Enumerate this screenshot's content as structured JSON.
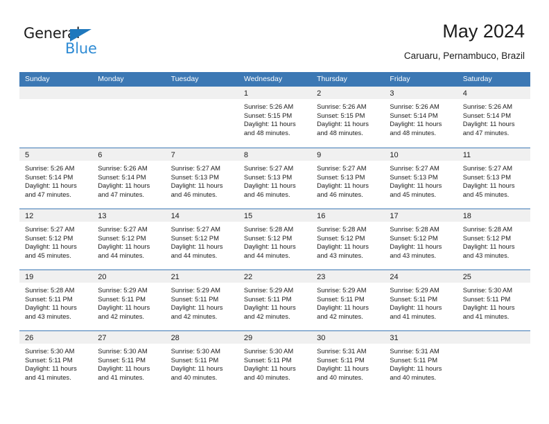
{
  "brand": {
    "name_top": "General",
    "name_bottom": "Blue",
    "triangle_icon": "triangle-icon",
    "color_dark": "#1b1b1b",
    "color_blue": "#2e8bd4",
    "triangle_color": "#1f78bd"
  },
  "header": {
    "title": "May 2024",
    "subtitle": "Caruaru, Pernambuco, Brazil"
  },
  "theme": {
    "header_bg": "#3c78b4",
    "header_text": "#ffffff",
    "day_band_bg": "#f0f0f0",
    "row_divider": "#3c78b4",
    "page_bg": "#ffffff",
    "text": "#1b1b1b"
  },
  "weekdays": [
    "Sunday",
    "Monday",
    "Tuesday",
    "Wednesday",
    "Thursday",
    "Friday",
    "Saturday"
  ],
  "weeks": [
    [
      {
        "day": "",
        "lines": []
      },
      {
        "day": "",
        "lines": []
      },
      {
        "day": "",
        "lines": []
      },
      {
        "day": "1",
        "lines": [
          "Sunrise: 5:26 AM",
          "Sunset: 5:15 PM",
          "Daylight: 11 hours",
          "and 48 minutes."
        ]
      },
      {
        "day": "2",
        "lines": [
          "Sunrise: 5:26 AM",
          "Sunset: 5:15 PM",
          "Daylight: 11 hours",
          "and 48 minutes."
        ]
      },
      {
        "day": "3",
        "lines": [
          "Sunrise: 5:26 AM",
          "Sunset: 5:14 PM",
          "Daylight: 11 hours",
          "and 48 minutes."
        ]
      },
      {
        "day": "4",
        "lines": [
          "Sunrise: 5:26 AM",
          "Sunset: 5:14 PM",
          "Daylight: 11 hours",
          "and 47 minutes."
        ]
      }
    ],
    [
      {
        "day": "5",
        "lines": [
          "Sunrise: 5:26 AM",
          "Sunset: 5:14 PM",
          "Daylight: 11 hours",
          "and 47 minutes."
        ]
      },
      {
        "day": "6",
        "lines": [
          "Sunrise: 5:26 AM",
          "Sunset: 5:14 PM",
          "Daylight: 11 hours",
          "and 47 minutes."
        ]
      },
      {
        "day": "7",
        "lines": [
          "Sunrise: 5:27 AM",
          "Sunset: 5:13 PM",
          "Daylight: 11 hours",
          "and 46 minutes."
        ]
      },
      {
        "day": "8",
        "lines": [
          "Sunrise: 5:27 AM",
          "Sunset: 5:13 PM",
          "Daylight: 11 hours",
          "and 46 minutes."
        ]
      },
      {
        "day": "9",
        "lines": [
          "Sunrise: 5:27 AM",
          "Sunset: 5:13 PM",
          "Daylight: 11 hours",
          "and 46 minutes."
        ]
      },
      {
        "day": "10",
        "lines": [
          "Sunrise: 5:27 AM",
          "Sunset: 5:13 PM",
          "Daylight: 11 hours",
          "and 45 minutes."
        ]
      },
      {
        "day": "11",
        "lines": [
          "Sunrise: 5:27 AM",
          "Sunset: 5:13 PM",
          "Daylight: 11 hours",
          "and 45 minutes."
        ]
      }
    ],
    [
      {
        "day": "12",
        "lines": [
          "Sunrise: 5:27 AM",
          "Sunset: 5:12 PM",
          "Daylight: 11 hours",
          "and 45 minutes."
        ]
      },
      {
        "day": "13",
        "lines": [
          "Sunrise: 5:27 AM",
          "Sunset: 5:12 PM",
          "Daylight: 11 hours",
          "and 44 minutes."
        ]
      },
      {
        "day": "14",
        "lines": [
          "Sunrise: 5:27 AM",
          "Sunset: 5:12 PM",
          "Daylight: 11 hours",
          "and 44 minutes."
        ]
      },
      {
        "day": "15",
        "lines": [
          "Sunrise: 5:28 AM",
          "Sunset: 5:12 PM",
          "Daylight: 11 hours",
          "and 44 minutes."
        ]
      },
      {
        "day": "16",
        "lines": [
          "Sunrise: 5:28 AM",
          "Sunset: 5:12 PM",
          "Daylight: 11 hours",
          "and 43 minutes."
        ]
      },
      {
        "day": "17",
        "lines": [
          "Sunrise: 5:28 AM",
          "Sunset: 5:12 PM",
          "Daylight: 11 hours",
          "and 43 minutes."
        ]
      },
      {
        "day": "18",
        "lines": [
          "Sunrise: 5:28 AM",
          "Sunset: 5:12 PM",
          "Daylight: 11 hours",
          "and 43 minutes."
        ]
      }
    ],
    [
      {
        "day": "19",
        "lines": [
          "Sunrise: 5:28 AM",
          "Sunset: 5:11 PM",
          "Daylight: 11 hours",
          "and 43 minutes."
        ]
      },
      {
        "day": "20",
        "lines": [
          "Sunrise: 5:29 AM",
          "Sunset: 5:11 PM",
          "Daylight: 11 hours",
          "and 42 minutes."
        ]
      },
      {
        "day": "21",
        "lines": [
          "Sunrise: 5:29 AM",
          "Sunset: 5:11 PM",
          "Daylight: 11 hours",
          "and 42 minutes."
        ]
      },
      {
        "day": "22",
        "lines": [
          "Sunrise: 5:29 AM",
          "Sunset: 5:11 PM",
          "Daylight: 11 hours",
          "and 42 minutes."
        ]
      },
      {
        "day": "23",
        "lines": [
          "Sunrise: 5:29 AM",
          "Sunset: 5:11 PM",
          "Daylight: 11 hours",
          "and 42 minutes."
        ]
      },
      {
        "day": "24",
        "lines": [
          "Sunrise: 5:29 AM",
          "Sunset: 5:11 PM",
          "Daylight: 11 hours",
          "and 41 minutes."
        ]
      },
      {
        "day": "25",
        "lines": [
          "Sunrise: 5:30 AM",
          "Sunset: 5:11 PM",
          "Daylight: 11 hours",
          "and 41 minutes."
        ]
      }
    ],
    [
      {
        "day": "26",
        "lines": [
          "Sunrise: 5:30 AM",
          "Sunset: 5:11 PM",
          "Daylight: 11 hours",
          "and 41 minutes."
        ]
      },
      {
        "day": "27",
        "lines": [
          "Sunrise: 5:30 AM",
          "Sunset: 5:11 PM",
          "Daylight: 11 hours",
          "and 41 minutes."
        ]
      },
      {
        "day": "28",
        "lines": [
          "Sunrise: 5:30 AM",
          "Sunset: 5:11 PM",
          "Daylight: 11 hours",
          "and 40 minutes."
        ]
      },
      {
        "day": "29",
        "lines": [
          "Sunrise: 5:30 AM",
          "Sunset: 5:11 PM",
          "Daylight: 11 hours",
          "and 40 minutes."
        ]
      },
      {
        "day": "30",
        "lines": [
          "Sunrise: 5:31 AM",
          "Sunset: 5:11 PM",
          "Daylight: 11 hours",
          "and 40 minutes."
        ]
      },
      {
        "day": "31",
        "lines": [
          "Sunrise: 5:31 AM",
          "Sunset: 5:11 PM",
          "Daylight: 11 hours",
          "and 40 minutes."
        ]
      },
      {
        "day": "",
        "lines": []
      }
    ]
  ]
}
